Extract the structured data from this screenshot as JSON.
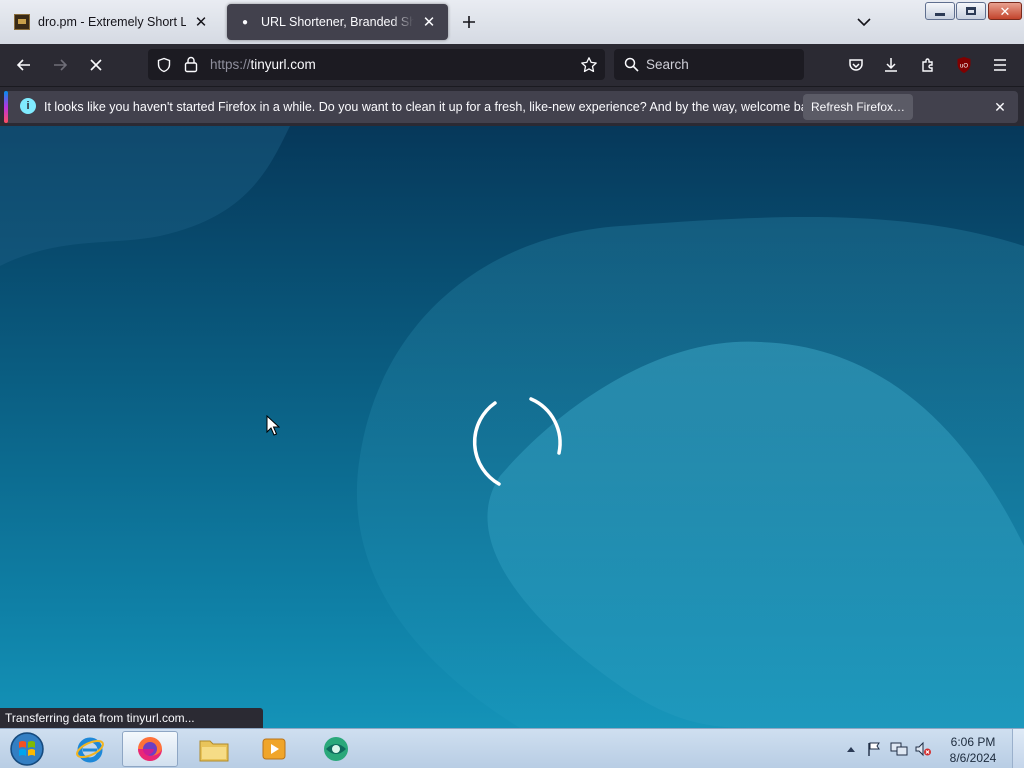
{
  "tabs": [
    {
      "title": "dro.pm - Extremely Short Links",
      "active": false
    },
    {
      "title": "URL Shortener, Branded Short Links & Analytics | TinyURL",
      "active": true
    }
  ],
  "toolbar": {
    "url_scheme": "https://",
    "url_host": "tinyurl.com",
    "search_placeholder": "Search"
  },
  "notification": {
    "message": "It looks like you haven't started Firefox in a while. Do you want to clean it up for a fresh, like-new experience? And by the way, welcome back!",
    "button_label": "Refresh Firefox…"
  },
  "status_text": "Transferring data from tinyurl.com...",
  "taskbar": {
    "clock_time": "6:06 PM",
    "clock_date": "8/6/2024"
  },
  "colors": {
    "toolbar": "#2b2a33",
    "urlbar": "#1c1b22",
    "page_bg_top": "#06385a",
    "page_bg_bottom": "#1493b8"
  }
}
